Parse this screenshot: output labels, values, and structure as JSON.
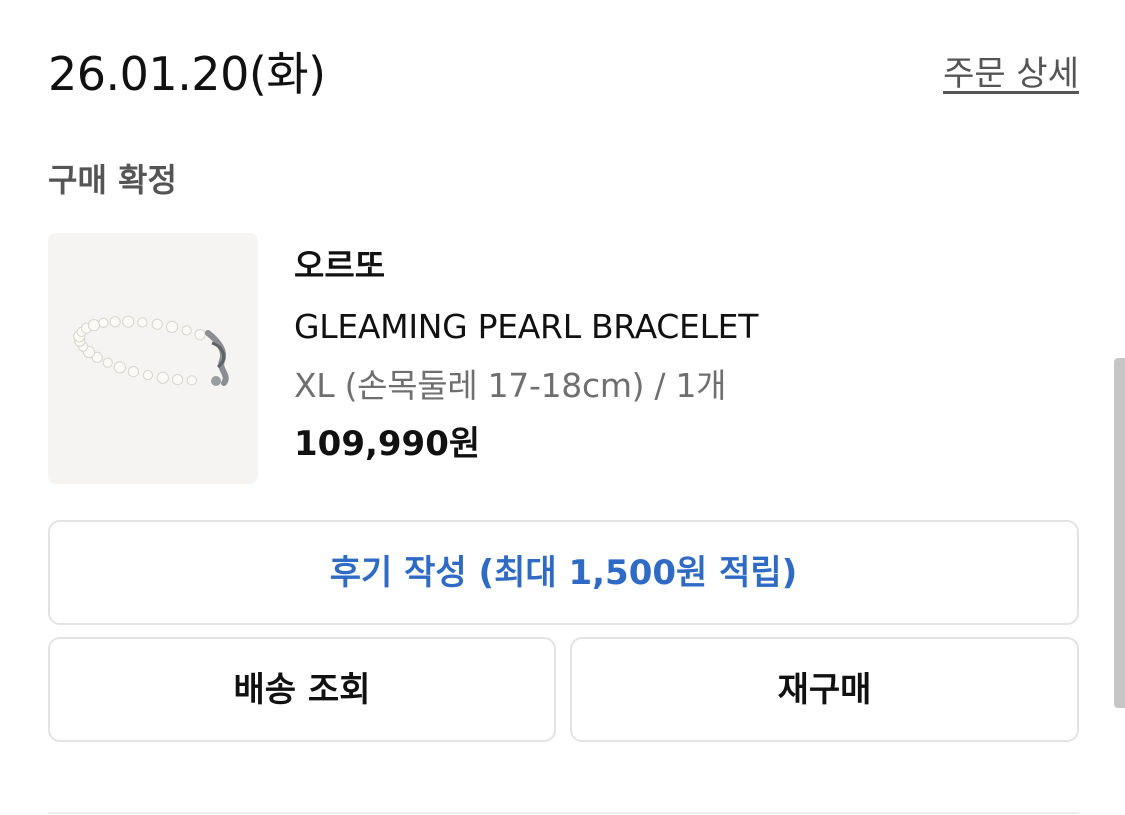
{
  "order": {
    "date": "26.01.20(화)",
    "detail_link": "주문 상세",
    "status": "구매 확정"
  },
  "product": {
    "brand": "오르또",
    "name": "GLEAMING PEARL BRACELET",
    "option": "XL (손목둘레 17-18cm) / 1개",
    "price": "109,990원",
    "image_icon": "pearl-bracelet-image"
  },
  "actions": {
    "review_label": "후기 작성 (최대 1,500원 적립)",
    "tracking_label": "배송 조회",
    "rebuy_label": "재구매"
  },
  "colors": {
    "review_accent": "#2f6bc4",
    "border": "#e3e3e3",
    "muted_text": "#6f6f6f"
  }
}
